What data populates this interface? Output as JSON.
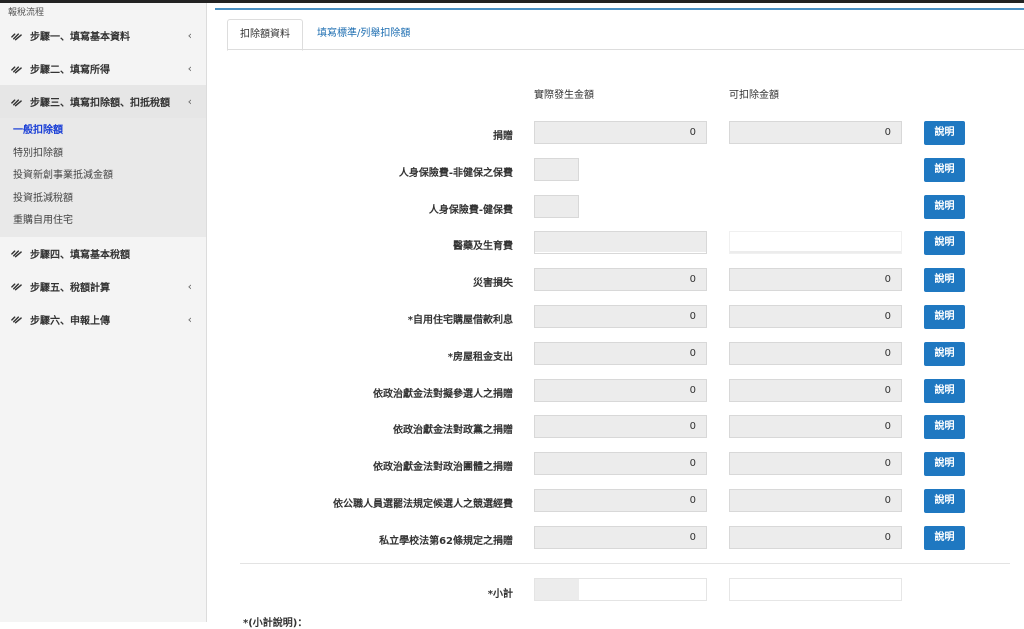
{
  "sidebar": {
    "title": "報稅流程",
    "steps": [
      {
        "label": "步驟一、填寫基本資料",
        "chevron": "‹"
      },
      {
        "label": "步驟二、填寫所得",
        "chevron": "‹"
      },
      {
        "label": "步驟三、填寫扣除額、扣抵稅額",
        "chevron": "‹"
      },
      {
        "label": "步驟四、填寫基本稅額",
        "chevron": ""
      },
      {
        "label": "步驟五、稅額計算",
        "chevron": "‹"
      },
      {
        "label": "步驟六、申報上傳",
        "chevron": "‹"
      }
    ],
    "substeps": [
      "一般扣除額",
      "特別扣除額",
      "投資新創事業抵減金額",
      "投資抵減稅額",
      "重購自用住宅"
    ]
  },
  "tabs": [
    "扣除額資料",
    "填寫標準/列舉扣除額"
  ],
  "columns": {
    "actual": "實際發生金額",
    "deductible": "可扣除金額"
  },
  "button_label": "說明",
  "rows": [
    {
      "label": "捐贈",
      "actual": "0",
      "deductible": "0"
    },
    {
      "label": "人身保險費-非健保之保費",
      "actual": "",
      "deductible": ""
    },
    {
      "label": "人身保險費-健保費",
      "actual": "",
      "deductible": ""
    },
    {
      "label": "醫藥及生育費",
      "actual": "",
      "deductible": ""
    },
    {
      "label": "災害損失",
      "actual": "0",
      "deductible": "0"
    },
    {
      "label": "*自用住宅購屋借款利息",
      "actual": "0",
      "deductible": "0"
    },
    {
      "label": "*房屋租金支出",
      "actual": "0",
      "deductible": "0"
    },
    {
      "label": "依政治獻金法對擬參選人之捐贈",
      "actual": "0",
      "deductible": "0"
    },
    {
      "label": "依政治獻金法對政黨之捐贈",
      "actual": "0",
      "deductible": "0"
    },
    {
      "label": "依政治獻金法對政治團體之捐贈",
      "actual": "0",
      "deductible": "0"
    },
    {
      "label": "依公職人員選罷法規定候選人之競選經費",
      "actual": "0",
      "deductible": "0"
    },
    {
      "label": "私立學校法第62條規定之捐贈",
      "actual": "0",
      "deductible": "0"
    }
  ],
  "subtotal_label": "*小計",
  "note_label": "*(小計說明)："
}
